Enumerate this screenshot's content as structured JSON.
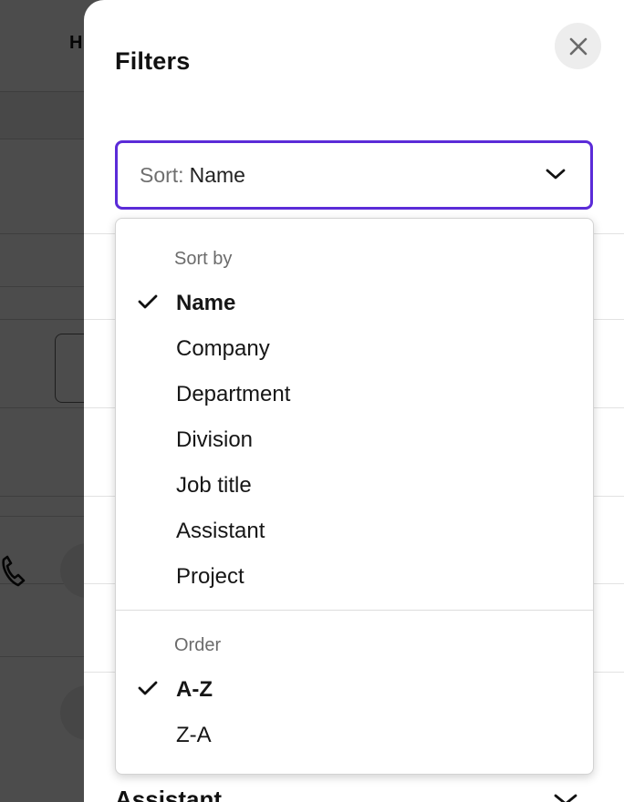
{
  "background": {
    "header_letter": "H"
  },
  "panel": {
    "title": "Filters",
    "sort_label": "Sort:",
    "sort_value": "Name",
    "bottom_label": "Assistant"
  },
  "menu": {
    "sort_group_label": "Sort by",
    "sort_options": [
      {
        "label": "Name",
        "selected": true
      },
      {
        "label": "Company",
        "selected": false
      },
      {
        "label": "Department",
        "selected": false
      },
      {
        "label": "Division",
        "selected": false
      },
      {
        "label": "Job title",
        "selected": false
      },
      {
        "label": "Assistant",
        "selected": false
      },
      {
        "label": "Project",
        "selected": false
      }
    ],
    "order_group_label": "Order",
    "order_options": [
      {
        "label": "A-Z",
        "selected": true
      },
      {
        "label": "Z-A",
        "selected": false
      }
    ]
  },
  "colors": {
    "accent": "#5b2bd8",
    "overlay": "#000000"
  },
  "icons": {
    "close": "close-icon",
    "chevron": "chevron-down-icon",
    "check": "check-icon",
    "phone": "phone-icon"
  }
}
